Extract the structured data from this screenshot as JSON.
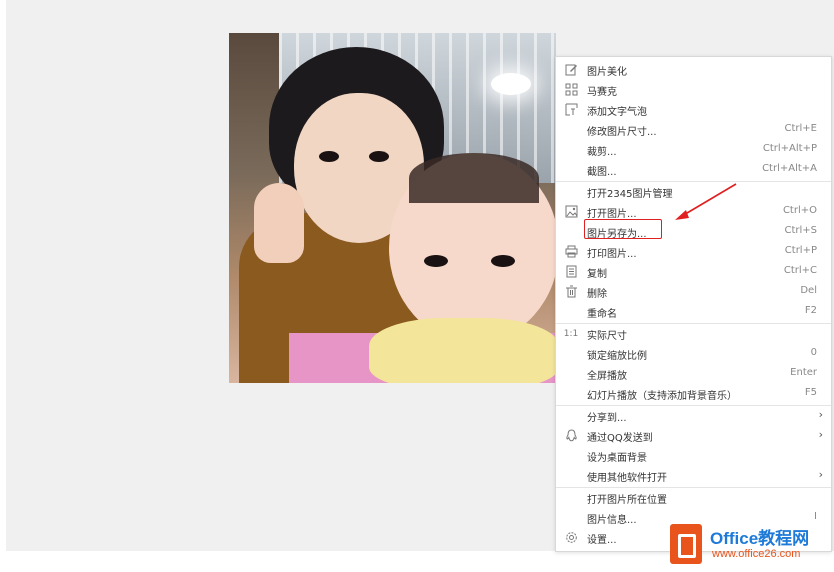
{
  "menu": {
    "items": [
      {
        "label": "图片美化",
        "shortcut": "",
        "icon": "edit-icon"
      },
      {
        "label": "马赛克",
        "shortcut": "",
        "icon": "mosaic-icon"
      },
      {
        "label": "添加文字气泡",
        "shortcut": "",
        "icon": "text-bubble-icon"
      },
      {
        "label": "修改图片尺寸...",
        "shortcut": "Ctrl+E",
        "icon": ""
      },
      {
        "label": "裁剪...",
        "shortcut": "Ctrl+Alt+P",
        "icon": ""
      },
      {
        "label": "截图...",
        "shortcut": "Ctrl+Alt+A",
        "icon": ""
      },
      {
        "label": "打开2345图片管理",
        "shortcut": "",
        "icon": ""
      },
      {
        "label": "打开图片...",
        "shortcut": "Ctrl+O",
        "icon": "image-icon"
      },
      {
        "label": "图片另存为...",
        "shortcut": "Ctrl+S",
        "icon": ""
      },
      {
        "label": "打印图片...",
        "shortcut": "Ctrl+P",
        "icon": "printer-icon"
      },
      {
        "label": "复制",
        "shortcut": "Ctrl+C",
        "icon": "copy-icon"
      },
      {
        "label": "删除",
        "shortcut": "Del",
        "icon": "trash-icon"
      },
      {
        "label": "重命名",
        "shortcut": "F2",
        "icon": ""
      },
      {
        "label": "实际尺寸",
        "shortcut": "",
        "icon": "actual-size-icon"
      },
      {
        "label": "锁定缩放比例",
        "shortcut": "0",
        "icon": ""
      },
      {
        "label": "全屏播放",
        "shortcut": "Enter",
        "icon": ""
      },
      {
        "label": "幻灯片播放（支持添加背景音乐）",
        "shortcut": "F5",
        "icon": ""
      },
      {
        "label": "分享到...",
        "shortcut": "",
        "icon": "",
        "submenu": true
      },
      {
        "label": "通过QQ发送到",
        "shortcut": "",
        "icon": "qq-icon",
        "submenu": true
      },
      {
        "label": "设为桌面背景",
        "shortcut": "",
        "icon": ""
      },
      {
        "label": "使用其他软件打开",
        "shortcut": "",
        "icon": "",
        "submenu": true
      },
      {
        "label": "打开图片所在位置",
        "shortcut": "",
        "icon": ""
      },
      {
        "label": "图片信息...",
        "shortcut": "I",
        "icon": ""
      },
      {
        "label": "设置...",
        "shortcut": "",
        "icon": "gear-icon"
      }
    ],
    "actual_size_glyph": "1:1",
    "submenu_glyph": "›"
  },
  "watermark": {
    "title": "Office教程网",
    "url": "www.office26.com"
  },
  "colors": {
    "highlight": "#e02020",
    "arrow": "#e02020",
    "watermark_blue": "#1e7ad8",
    "watermark_orange": "#e8541c"
  }
}
